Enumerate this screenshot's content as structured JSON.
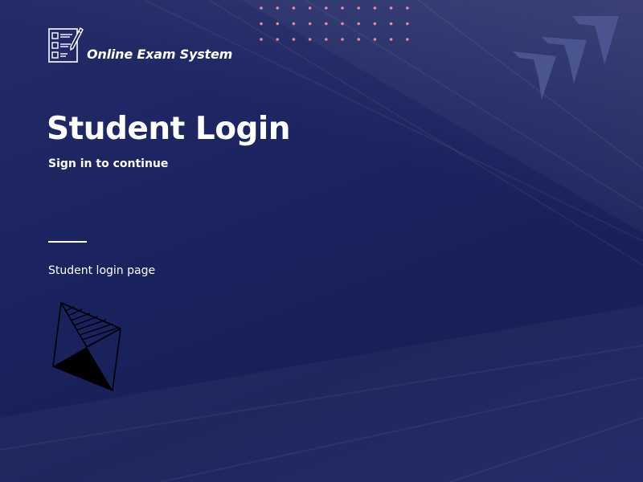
{
  "brand": {
    "name": "Online Exam System",
    "icon": "checklist-pencil-icon"
  },
  "hero": {
    "title": "Student Login",
    "subtitle": "Sign in to continue",
    "description": "Student login page"
  },
  "decor": {
    "dots_icon": "dot-grid-icon",
    "chevrons_icon": "triple-chevron-icon",
    "shape_icon": "geometric-diamond-icon"
  },
  "colors": {
    "background": "#1a2259",
    "text": "#ffffff",
    "dot_accent": "#e88aa0",
    "chevron": "#4a5590"
  }
}
